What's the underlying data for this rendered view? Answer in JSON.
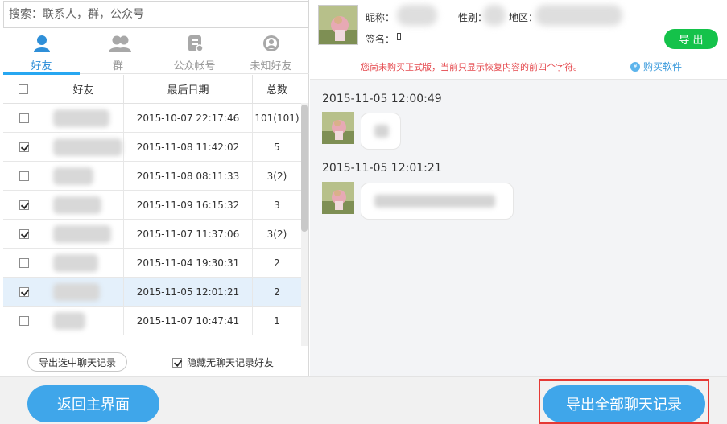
{
  "search": {
    "placeholder": "搜索：联系人，群，公众号"
  },
  "tabs": [
    {
      "label": "好友",
      "icon": "person-icon",
      "active": true
    },
    {
      "label": "群",
      "icon": "group-icon",
      "active": false
    },
    {
      "label": "公众帐号",
      "icon": "official-account-icon",
      "active": false
    },
    {
      "label": "未知好友",
      "icon": "unknown-friend-icon",
      "active": false
    }
  ],
  "table": {
    "headers": {
      "friend": "好友",
      "last_date": "最后日期",
      "total": "总数"
    },
    "rows": [
      {
        "checked": false,
        "date": "2015-10-07 22:17:46",
        "total": "101(101)",
        "selected": false
      },
      {
        "checked": true,
        "date": "2015-11-08 11:42:02",
        "total": "5",
        "selected": false
      },
      {
        "checked": false,
        "date": "2015-11-08 08:11:33",
        "total": "3(2)",
        "selected": false
      },
      {
        "checked": true,
        "date": "2015-11-09 16:15:32",
        "total": "3",
        "selected": false
      },
      {
        "checked": true,
        "date": "2015-11-07 11:37:06",
        "total": "3(2)",
        "selected": false
      },
      {
        "checked": false,
        "date": "2015-11-04 19:30:31",
        "total": "2",
        "selected": false
      },
      {
        "checked": true,
        "date": "2015-11-05 12:01:21",
        "total": "2",
        "selected": true
      },
      {
        "checked": false,
        "date": "2015-11-07 10:47:41",
        "total": "1",
        "selected": false
      }
    ]
  },
  "left_bottom": {
    "export_selected": "导出选中聊天记录",
    "hide_label": "隐藏无聊天记录好友",
    "hide_checked": true
  },
  "profile": {
    "nickname_label": "昵称：",
    "gender_label": "性别：",
    "region_label": "地区：",
    "signature_label": "签名：",
    "export_button": "导 出"
  },
  "notice": {
    "text": "您尚未购买正式版，当前只显示恢复内容的前四个字符。",
    "buy_link": "购买软件"
  },
  "chat": {
    "messages": [
      {
        "timestamp": "2015-11-05 12:00:49"
      },
      {
        "timestamp": "2015-11-05 12:01:21"
      }
    ]
  },
  "footer": {
    "back_button": "返回主界面",
    "export_all_button": "导出全部聊天记录"
  },
  "colors": {
    "accent_blue": "#3fa6ea",
    "export_green": "#14c24a",
    "notice_red": "#e5484d",
    "highlight_red": "#e53935"
  }
}
